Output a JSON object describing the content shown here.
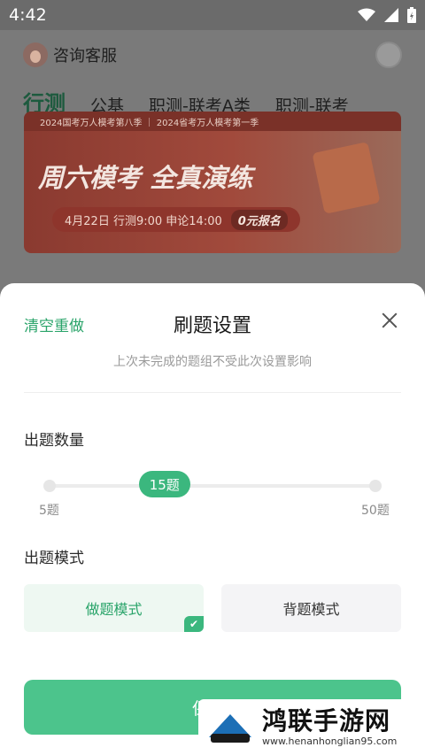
{
  "status_bar": {
    "time": "4:42"
  },
  "header": {
    "customer_service_label": "咨询客服"
  },
  "tabs": [
    {
      "label": "行测"
    },
    {
      "label": "公基"
    },
    {
      "label": "职测-联考A类"
    },
    {
      "label": "职测-联考"
    }
  ],
  "banner": {
    "strip_text": "2024国考万人模考第八季 ｜ 2024省考万人模考第一季",
    "headline": "周六模考 全真演练",
    "schedule": "4月22日  行测9:00  申论14:00",
    "badge": "0元报名"
  },
  "sheet": {
    "clear_label": "清空重做",
    "title": "刷题设置",
    "subtitle": "上次未完成的题组不受此次设置影响",
    "count_section": "出题数量",
    "slider": {
      "min_label": "5题",
      "max_label": "50题",
      "value_label": "15题",
      "min": 5,
      "max": 50,
      "value": 15
    },
    "mode_section": "出题模式",
    "modes": [
      {
        "label": "做题模式",
        "selected": true
      },
      {
        "label": "背题模式",
        "selected": false
      }
    ],
    "save_label": "保"
  },
  "watermark": {
    "name": "鸿联手游网",
    "url": "www.henanhonglian95.com"
  },
  "colors": {
    "accent": "#3bb77e",
    "accent_text": "#2aa46a",
    "overlay": "#5f5f5f"
  }
}
